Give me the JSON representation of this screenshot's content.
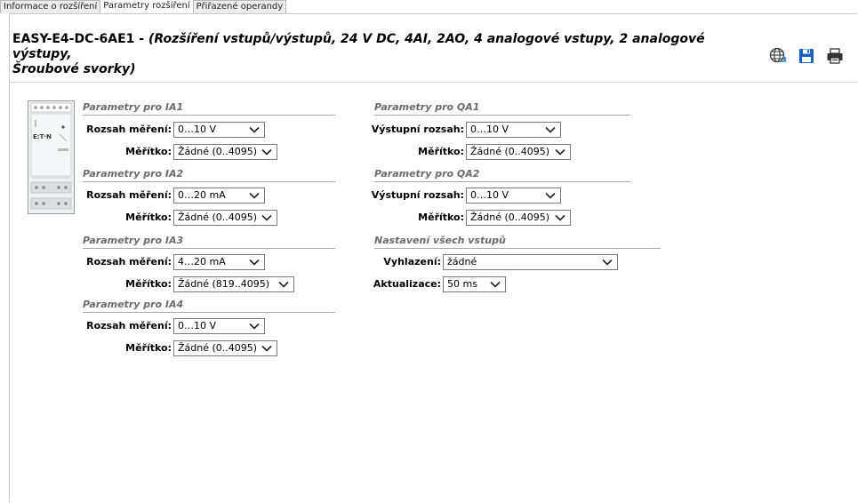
{
  "tabs": [
    "Informace o rozšíření",
    "Parametry rozšíření",
    "Přiřazené operandy"
  ],
  "title": {
    "model": "EASY-E4-DC-6AE1",
    "dash": " - ",
    "description": "(Rozšíření vstupů/výstupů, 24 V DC, 4AI, 2AO, 4 analogové vstupy, 2 analogové výstupy,",
    "description_line2": "Šroubové svorky)"
  },
  "toolbar": {
    "icons": [
      "globe-icon",
      "save-icon",
      "print-icon"
    ]
  },
  "device": {
    "brand": "E:T·N"
  },
  "groups": {
    "ia1": {
      "header": "Parametry pro IA1",
      "range_label": "Rozsah měření:",
      "range_value": "0…10 V",
      "scale_label": "Měřítko:",
      "scale_value": "Žádné (0..4095)"
    },
    "ia2": {
      "header": "Parametry pro IA2",
      "range_label": "Rozsah měření:",
      "range_value": "0…20 mA",
      "scale_label": "Měřítko:",
      "scale_value": "Žádné (0..4095)"
    },
    "ia3": {
      "header": "Parametry pro IA3",
      "range_label": "Rozsah měření:",
      "range_value": "4…20 mA",
      "scale_label": "Měřítko:",
      "scale_value": "Žádné (819..4095)"
    },
    "ia4": {
      "header": "Parametry pro IA4",
      "range_label": "Rozsah měření:",
      "range_value": "0…10 V",
      "scale_label": "Měřítko:",
      "scale_value": "Žádné (0..4095)"
    },
    "qa1": {
      "header": "Parametry pro QA1",
      "range_label": "Výstupní rozsah:",
      "range_value": "0…10 V",
      "scale_label": "Měřítko:",
      "scale_value": "Žádné (0..4095)"
    },
    "qa2": {
      "header": "Parametry pro QA2",
      "range_label": "Výstupní rozsah:",
      "range_value": "0…10 V",
      "scale_label": "Měřítko:",
      "scale_value": "Žádné (0..4095)"
    },
    "all": {
      "header": "Nastavení všech vstupů",
      "smooth_label": "Vyhlazení:",
      "smooth_value": "žádné",
      "update_label": "Aktualizace:",
      "update_value": "50 ms"
    }
  }
}
